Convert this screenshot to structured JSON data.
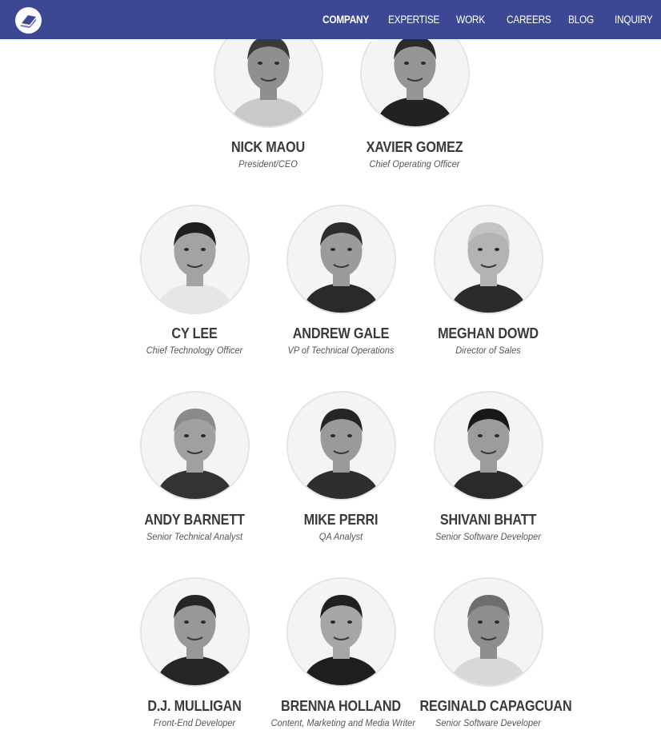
{
  "nav": {
    "items": [
      {
        "label": "COMPANY",
        "active": true
      },
      {
        "label": "EXPERTISE",
        "active": false
      },
      {
        "label": "WORK",
        "active": false
      },
      {
        "label": "CAREERS",
        "active": false
      },
      {
        "label": "BLOG",
        "active": false
      },
      {
        "label": "INQUIRY",
        "active": false
      }
    ]
  },
  "colors": {
    "nav_bg": "#3d4894",
    "name_text": "#3a3a3a",
    "role_text": "#555555",
    "avatar_border": "#e4e4e4"
  },
  "team": [
    {
      "name": "NICK MAOU",
      "role": "President/CEO",
      "skin": "#8f8f8f",
      "hair": "#3a3a3a",
      "shirt": "#c9c9c9"
    },
    {
      "name": "XAVIER GOMEZ",
      "role": "Chief Operating Officer",
      "skin": "#959595",
      "hair": "#2a2a2a",
      "shirt": "#222222"
    },
    {
      "name": "CY LEE",
      "role": "Chief Technology Officer",
      "skin": "#a3a3a3",
      "hair": "#1e1e1e",
      "shirt": "#e6e6e6"
    },
    {
      "name": "ANDREW GALE",
      "role": "VP of Technical Operations",
      "skin": "#9b9b9b",
      "hair": "#2c2c2c",
      "shirt": "#2a2a2a"
    },
    {
      "name": "MEGHAN DOWD",
      "role": "Director of Sales",
      "skin": "#b3b3b3",
      "hair": "#c4c4c4",
      "shirt": "#2b2b2b"
    },
    {
      "name": "ANDY BARNETT",
      "role": "Senior Technical Analyst",
      "skin": "#a0a0a0",
      "hair": "#8a8a8a",
      "shirt": "#333333"
    },
    {
      "name": "MIKE PERRI",
      "role": "QA Analyst",
      "skin": "#9a9a9a",
      "hair": "#252525",
      "shirt": "#2e2e2e"
    },
    {
      "name": "SHIVANI BHATT",
      "role": "Senior Software Developer",
      "skin": "#9c9c9c",
      "hair": "#181818",
      "shirt": "#2a2a2a"
    },
    {
      "name": "D.J. MULLIGAN",
      "role": "Front-End Developer",
      "skin": "#989898",
      "hair": "#252525",
      "shirt": "#262626"
    },
    {
      "name": "BRENNA HOLLAND",
      "role": "Content, Marketing and Media Writer",
      "skin": "#a6a6a6",
      "hair": "#202020",
      "shirt": "#1e1e1e"
    },
    {
      "name": "REGINALD CAPAGCUAN",
      "role": "Senior Software Developer",
      "skin": "#8e8e8e",
      "hair": "#6e6e6e",
      "shirt": "#d8d8d8"
    }
  ]
}
